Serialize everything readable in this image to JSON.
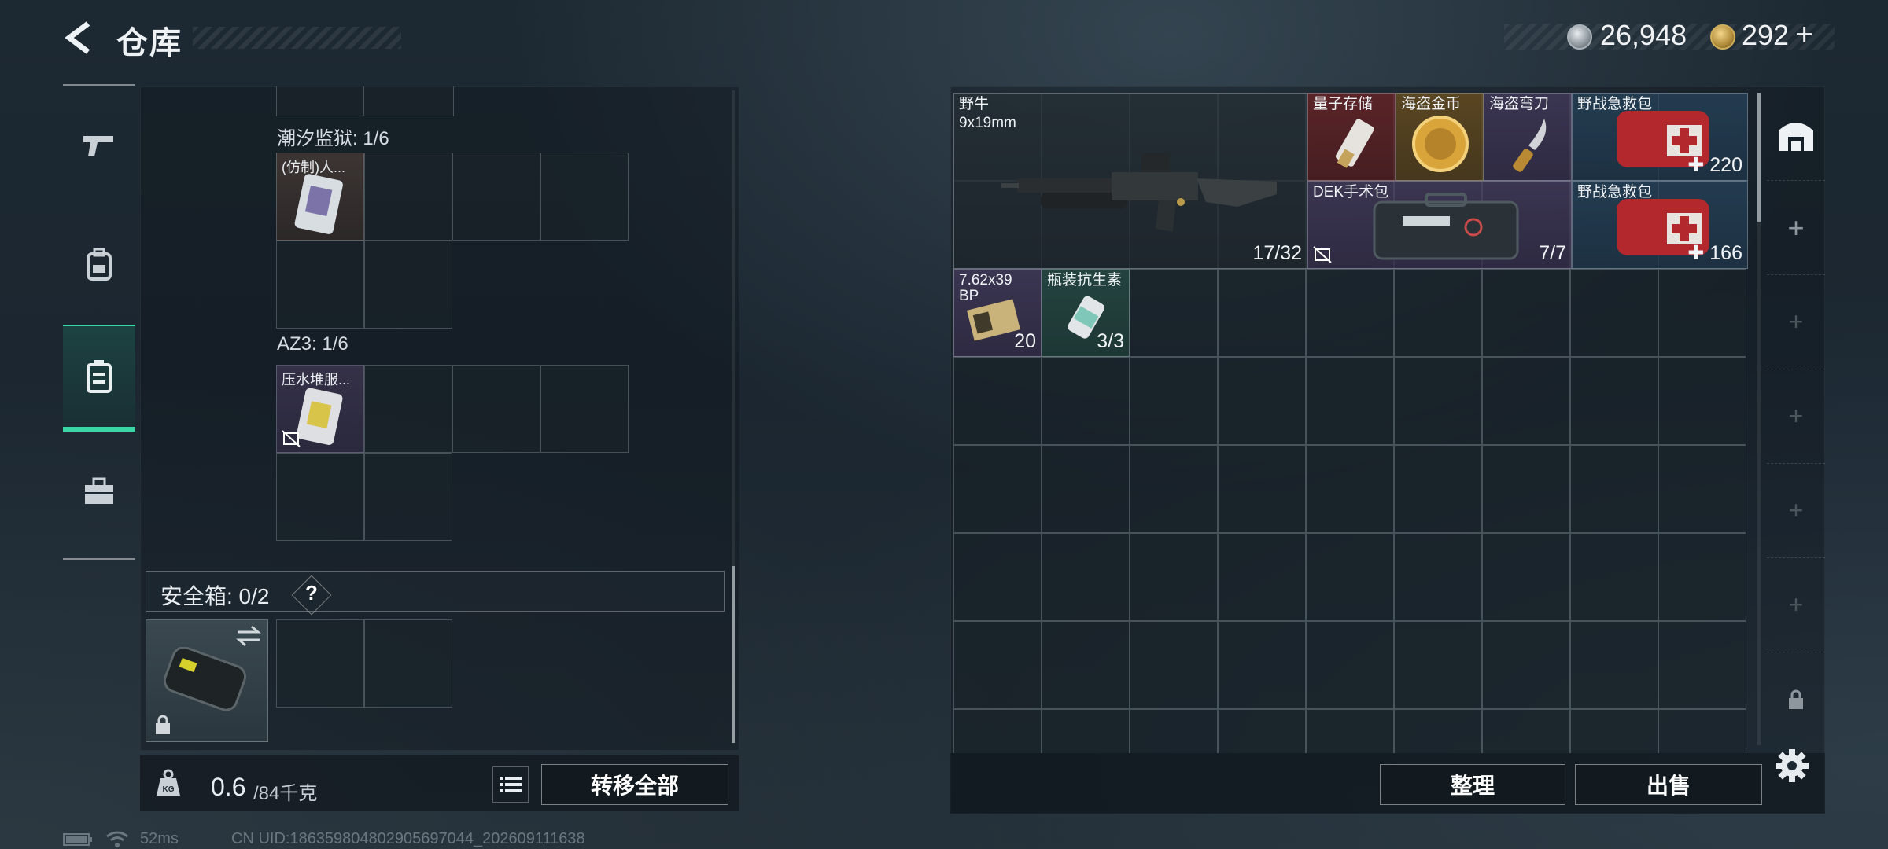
{
  "header": {
    "title": "仓库",
    "currency_silver": "26,948",
    "currency_gold": "292",
    "currency_plus": "+"
  },
  "left_nav": {
    "items": [
      {
        "icon": "pistol-icon"
      },
      {
        "icon": "backpack-icon"
      },
      {
        "icon": "rig-icon",
        "active": true
      },
      {
        "icon": "case-icon"
      }
    ]
  },
  "left_panel": {
    "container1": {
      "label": "潮汐监狱: 1/6",
      "item_name": "(仿制)人..."
    },
    "container2": {
      "label": "AZ3: 1/6",
      "item_name": "压水堆服..."
    },
    "safebox": {
      "label": "安全箱: 0/2",
      "help": "?"
    },
    "weight": {
      "current": "0.6",
      "max": "/84千克"
    },
    "transfer_all": "转移全部"
  },
  "stash": {
    "items": [
      {
        "name": "野牛",
        "sub": "9x19mm",
        "count": "17/32"
      },
      {
        "name": "量子存储"
      },
      {
        "name": "海盗金币"
      },
      {
        "name": "海盗弯刀"
      },
      {
        "name": "野战急救包",
        "count": "220"
      },
      {
        "name": "DEK手术包",
        "count": "7/7"
      },
      {
        "name": "野战急救包",
        "count": "166"
      },
      {
        "name": "7.62x39",
        "sub": "BP",
        "count": "20"
      },
      {
        "name": "瓶装抗生素",
        "count": "3/3"
      }
    ],
    "organize": "整理",
    "sell": "出售"
  },
  "status": {
    "ping": "52ms",
    "uid": "CN UID:1863598048029056970​44_202609111638"
  },
  "colors": {
    "accent": "#3bd6a6",
    "red_rarity": "#6e2326",
    "gold_rarity": "#6e501e",
    "purple_rarity": "#483c60"
  }
}
